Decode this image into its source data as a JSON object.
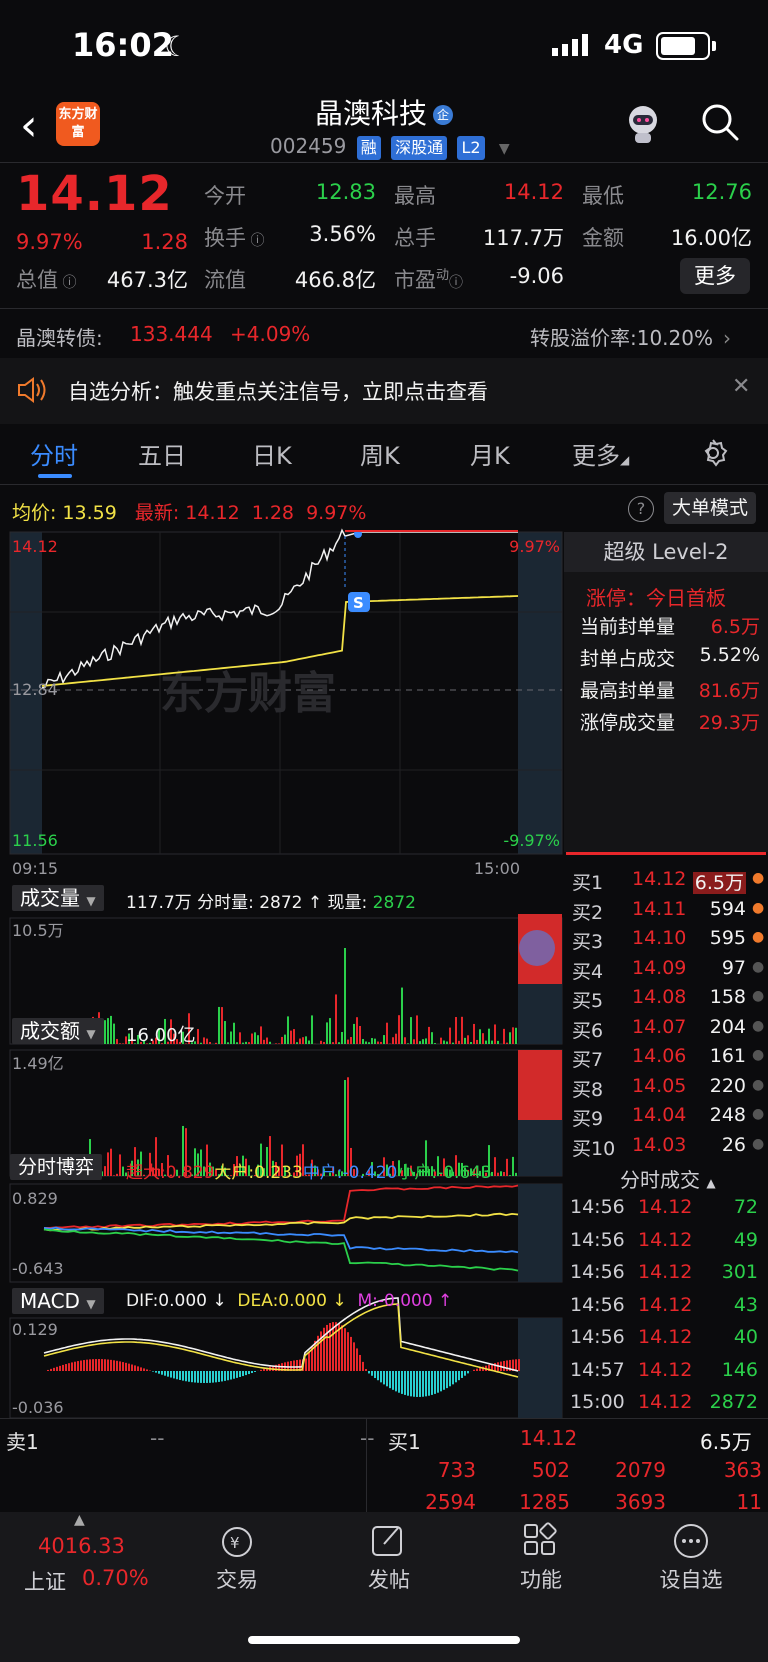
{
  "status_bar": {
    "time": "16:02",
    "network": "4G"
  },
  "header": {
    "logo_text": "东方财富",
    "stock_name": "晶澳科技",
    "badge": "企",
    "stock_code": "002459",
    "tags": [
      "融",
      "深股通",
      "L2"
    ]
  },
  "quote": {
    "price": "14.12",
    "change_pct": "9.97%",
    "change": "1.28",
    "open_label": "今开",
    "open": "12.83",
    "high_label": "最高",
    "high": "14.12",
    "low_label": "最低",
    "low": "12.76",
    "turnover_label": "换手",
    "turnover": "3.56%",
    "volume_label": "总手",
    "volume": "117.7万",
    "amount_label": "金额",
    "amount": "16.00亿",
    "mktcap_label": "总值",
    "mktcap": "467.3亿",
    "float_label": "流值",
    "float": "466.8亿",
    "pe_label": "市盈",
    "pe_sup": "动",
    "pe": "-9.06",
    "more": "更多"
  },
  "bond": {
    "label": "晶澳转债:",
    "price": "133.444",
    "pct": "+4.09%",
    "premium": "转股溢价率:10.20%"
  },
  "notice": {
    "text": "自选分析：触发重点关注信号，立即点击查看"
  },
  "tabs": [
    "分时",
    "五日",
    "日K",
    "周K",
    "月K",
    "更多"
  ],
  "chart_header": {
    "avg_label": "均价:",
    "avg": "13.59",
    "last_label": "最新:",
    "last": "14.12",
    "chg": "1.28",
    "pct": "9.97%",
    "mode": "大单模式"
  },
  "axis": {
    "top": "14.12",
    "mid": "12.84",
    "bottom": "11.56",
    "top_pct": "9.97%",
    "bottom_pct": "-9.97%",
    "t_start": "09:15",
    "t_end": "15:00",
    "s_marker": "S",
    "watermark": "东方财富"
  },
  "volume": {
    "title": "成交量",
    "info": "117.7万 分时量: 2872 ↑ 现量:",
    "now": "2872",
    "max": "10.5万"
  },
  "amount_pane": {
    "title": "成交额",
    "info": "16.00亿",
    "max": "1.49亿"
  },
  "game": {
    "title": "分时博弈",
    "super": "超大:0.829",
    "big": "大户:0.233",
    "mid": "中户:-0.420",
    "small": "小户:-0.643",
    "top": "0.829",
    "bottom": "-0.643"
  },
  "macd": {
    "title": "MACD",
    "dif": "DIF:0.000 ↓",
    "dea": "DEA:0.000 ↓",
    "m": "M:-0.000 ↑",
    "top": "0.129",
    "bottom": "-0.036"
  },
  "level2": {
    "title": "超级 Level-2",
    "limit_label": "涨停：今日首板",
    "rows": [
      {
        "label": "当前封单量",
        "value": "6.5万"
      },
      {
        "label": "封单占成交",
        "value": "5.52%"
      },
      {
        "label": "最高封单量",
        "value": "81.6万"
      },
      {
        "label": "涨停成交量",
        "value": "29.3万"
      }
    ]
  },
  "orderbook": [
    {
      "label": "买1",
      "price": "14.12",
      "qty": "6.5万"
    },
    {
      "label": "买2",
      "price": "14.11",
      "qty": "594"
    },
    {
      "label": "买3",
      "price": "14.10",
      "qty": "595"
    },
    {
      "label": "买4",
      "price": "14.09",
      "qty": "97"
    },
    {
      "label": "买5",
      "price": "14.08",
      "qty": "158"
    },
    {
      "label": "买6",
      "price": "14.07",
      "qty": "204"
    },
    {
      "label": "买7",
      "price": "14.06",
      "qty": "161"
    },
    {
      "label": "买8",
      "price": "14.05",
      "qty": "220"
    },
    {
      "label": "买9",
      "price": "14.04",
      "qty": "248"
    },
    {
      "label": "买10",
      "price": "14.03",
      "qty": "26"
    }
  ],
  "ticks": {
    "title": "分时成交",
    "rows": [
      {
        "t": "14:56",
        "p": "14.12",
        "v": "72"
      },
      {
        "t": "14:56",
        "p": "14.12",
        "v": "49"
      },
      {
        "t": "14:56",
        "p": "14.12",
        "v": "301"
      },
      {
        "t": "14:56",
        "p": "14.12",
        "v": "43"
      },
      {
        "t": "14:56",
        "p": "14.12",
        "v": "40"
      },
      {
        "t": "14:57",
        "p": "14.12",
        "v": "146"
      },
      {
        "t": "15:00",
        "p": "14.12",
        "v": "2872"
      }
    ]
  },
  "bottom_quote": {
    "sell1": "卖1",
    "sell_a": "--",
    "sell_b": "--",
    "buy1": "买1",
    "buy_price": "14.12",
    "buy_qty": "6.5万",
    "row1": [
      "733",
      "502",
      "2079",
      "363"
    ],
    "row2": [
      "2594",
      "1285",
      "3693",
      "11"
    ]
  },
  "footer": {
    "index_value": "4016.33",
    "index_name": "上证",
    "index_pct": "0.70%",
    "items": [
      "交易",
      "发帖",
      "功能",
      "设自选"
    ]
  },
  "colors": {
    "up": "#e8272b",
    "down": "#2bd04b",
    "avg": "#f2e246",
    "accent": "#3b8cff"
  }
}
